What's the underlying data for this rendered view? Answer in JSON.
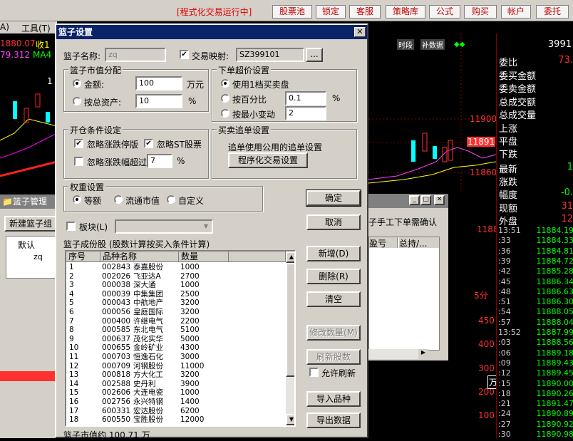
{
  "topbar": {
    "status": "[程式化交易运行中]",
    "buttons": [
      "股票池",
      "锁定",
      "客服",
      "策略库",
      "公式",
      "购买",
      "帐户",
      "委托"
    ]
  },
  "menubar": {
    "items": [
      "A)",
      "工具(T)"
    ]
  },
  "chart": {
    "ma_line1": "1880.07",
    "ma_line1_suffix": "收1",
    "ma_line2": "79.312",
    "ma_line2_suffix": "MA4",
    "tag1": "时段",
    "tag2": "补数据",
    "price_labels": [
      "11900",
      "11891",
      "11880",
      "11860"
    ],
    "left_val": "1",
    "vol_labels": [
      "5分",
      "450",
      "400",
      "300",
      "200",
      "100",
      "万"
    ]
  },
  "right_panel": {
    "top_value": "3991",
    "rows": [
      {
        "label": "委比",
        "value": "73."
      },
      {
        "label": "委买金额",
        "value": ""
      },
      {
        "label": "委卖金额",
        "value": ""
      },
      {
        "label": "总成交额",
        "value": ""
      },
      {
        "label": "总成交量",
        "value": ""
      },
      {
        "label": "上涨",
        "value": ""
      },
      {
        "label": "平盘",
        "value": ""
      },
      {
        "label": "下跌",
        "value": ""
      },
      {
        "label": "最新",
        "value": "1"
      },
      {
        "label": "涨跌",
        "value": ""
      },
      {
        "label": "幅度",
        "value": "-0."
      },
      {
        "label": "现额",
        "value": "31"
      },
      {
        "label": "外盘",
        "value": "12"
      }
    ],
    "ticks": [
      {
        "t": "13:51",
        "p": "11884.19"
      },
      {
        "t": ":33",
        "p": "11884.33"
      },
      {
        "t": ":36",
        "p": "11884.81"
      },
      {
        "t": ":39",
        "p": "11884.72"
      },
      {
        "t": ":42",
        "p": "11885.28"
      },
      {
        "t": ":45",
        "p": "11886.34"
      },
      {
        "t": ":48",
        "p": "11886.63"
      },
      {
        "t": ":51",
        "p": "11886.30"
      },
      {
        "t": ":54",
        "p": "11888.05"
      },
      {
        "t": ":57",
        "p": "11888.04"
      },
      {
        "t": "13:52",
        "p": "11887.99"
      },
      {
        "t": ":03",
        "p": "11888.56"
      },
      {
        "t": ":06",
        "p": "11889.18"
      },
      {
        "t": ":09",
        "p": "11889.43"
      },
      {
        "t": ":12",
        "p": "11889.45"
      },
      {
        "t": ":15",
        "p": "11890.00"
      },
      {
        "t": ":18",
        "p": "11890.26"
      },
      {
        "t": ":21",
        "p": "11891.47"
      },
      {
        "t": ":24",
        "p": "11890.89"
      },
      {
        "t": ":27",
        "p": "11890.92"
      },
      {
        "t": ":30",
        "p": "11890.98"
      }
    ]
  },
  "bg_window": {
    "title": "篮子管理",
    "new_button": "新建篮子组",
    "tree": [
      "默认",
      "zq"
    ],
    "manual_confirm": "子手工下单需确认",
    "col1": "盈亏",
    "col2": "总持/..."
  },
  "dialog": {
    "title": "篮子设置",
    "name_label": "篮子名称:",
    "name_value": "zq",
    "map_label": "交易映射:",
    "map_value": "SZ399101",
    "browse": "...",
    "market_group": "篮子市值分配",
    "amount_label": "金额:",
    "amount_value": "100",
    "amount_unit": "万元",
    "asset_label": "按总资产:",
    "asset_value": "10",
    "asset_unit": "%",
    "price_group": "下单超价设置",
    "price_opt1": "使用1档买卖盘",
    "price_opt2": "按百分比",
    "price_opt2_value": "0.1",
    "price_opt2_unit": "%",
    "price_opt3": "按最小变动",
    "price_opt3_value": "2",
    "open_group": "开仓条件设定",
    "chk_limit": "忽略涨跌停版",
    "chk_st": "忽略ST股票",
    "chk_range": "忽略涨跌幅超过",
    "range_value": "7",
    "range_unit": "%",
    "chase_group": "买卖追单设置",
    "chase_text": "追单使用公用的追单设置",
    "chase_button": "程序化交易设置",
    "weight_group": "权重设置",
    "w_equal": "等额",
    "w_float": "流通市值",
    "w_custom": "自定义",
    "block_label": "板块(L)",
    "comp_title": "篮子成份股 (股数计算按买入条件计算)",
    "columns": [
      "序号",
      "品种名称",
      "数量"
    ],
    "rows": [
      [
        "1",
        "002843",
        "泰嘉股份",
        "1000"
      ],
      [
        "2",
        "002026",
        "飞亚达A",
        "2700"
      ],
      [
        "3",
        "000038",
        "深大通",
        "1000"
      ],
      [
        "4",
        "000039",
        "中集集团",
        "2500"
      ],
      [
        "5",
        "000043",
        "中航地产",
        "3200"
      ],
      [
        "6",
        "000056",
        "皇庭国际",
        "3200"
      ],
      [
        "7",
        "000400",
        "许继电气",
        "2200"
      ],
      [
        "8",
        "000585",
        "东北电气",
        "5100"
      ],
      [
        "9",
        "000637",
        "茂化实华",
        "5000"
      ],
      [
        "10",
        "000655",
        "金岭矿业",
        "4300"
      ],
      [
        "11",
        "000703",
        "恒逸石化",
        "3000"
      ],
      [
        "12",
        "000709",
        "河钢股份",
        "11000"
      ],
      [
        "13",
        "000818",
        "方大化工",
        "3200"
      ],
      [
        "14",
        "002588",
        "史丹利",
        "3900"
      ],
      [
        "15",
        "002606",
        "大连电瓷",
        "1000"
      ],
      [
        "16",
        "002756",
        "永兴特钢",
        "1400"
      ],
      [
        "17",
        "600331",
        "宏达股份",
        "6200"
      ],
      [
        "18",
        "600550",
        "宝胜股份",
        "12000"
      ]
    ],
    "footer": "篮子市值约 100.71 万",
    "btn_ok": "确定",
    "btn_cancel": "取消",
    "btn_add": "新增(D)",
    "btn_delete": "删除(R)",
    "btn_clear": "清空",
    "btn_modify": "修改数量(M)",
    "btn_refresh": "刷新股数",
    "chk_allow_refresh": "允许刷新",
    "btn_import": "导入品种",
    "btn_export": "导出数据"
  }
}
